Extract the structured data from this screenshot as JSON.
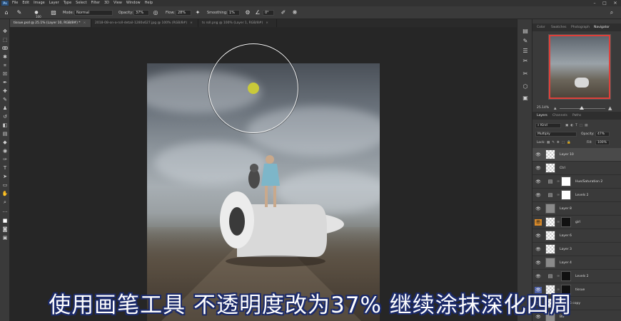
{
  "menubar": {
    "logo": "Ps",
    "items": [
      "File",
      "Edit",
      "Image",
      "Layer",
      "Type",
      "Select",
      "Filter",
      "3D",
      "View",
      "Window",
      "Help"
    ],
    "window_controls": [
      "–",
      "□",
      "✕"
    ]
  },
  "options": {
    "brush_size": "100",
    "mode_label": "Mode:",
    "mode_value": "Normal",
    "opacity_label": "Opacity:",
    "opacity_value": "37%",
    "flow_label": "Flow:",
    "flow_value": "28%",
    "smoothing_label": "Smoothing:",
    "smoothing_value": "1%",
    "angle_value": "0°"
  },
  "tabs": [
    {
      "label": "tissue.psd @ 25.1% (Layer 10, RGB/8#) *",
      "active": true
    },
    {
      "label": "2018-08-on-a-roll-detail-1280x627.jpg @ 100% (RGB/8#)",
      "active": false
    },
    {
      "label": "ts roll.png @ 100% (Layer 1, RGB/8#)",
      "active": false
    }
  ],
  "panels": {
    "top_tabs": [
      "Color",
      "Swatches",
      "Photograph",
      "Navigator"
    ],
    "zoom_value": "25.14%",
    "layers_tabs": [
      "Layers",
      "Channels",
      "Paths"
    ],
    "kind_label": "Kind",
    "blend_mode": "Multiply",
    "opacity_label": "Opacity:",
    "opacity_value": "47%",
    "lock_label": "Lock:",
    "fill_label": "Fill:",
    "fill_value": "100%"
  },
  "layers": [
    {
      "name": "Layer 10",
      "thumb": "checker",
      "active": true
    },
    {
      "name": "Ctrl",
      "thumb": "checker"
    },
    {
      "name": "Hue/Saturation 2",
      "thumb": "adjust",
      "mask": "white"
    },
    {
      "name": "Levels 2",
      "thumb": "adjust",
      "mask": "white"
    },
    {
      "name": "Layer 8",
      "thumb": "gray"
    },
    {
      "name": "girl",
      "thumb": "checker",
      "mask": "black",
      "highlight": "orange"
    },
    {
      "name": "Layer 6",
      "thumb": "checker"
    },
    {
      "name": "Layer 3",
      "thumb": "checker"
    },
    {
      "name": "Layer 4",
      "thumb": "gray"
    },
    {
      "name": "Levels 2",
      "thumb": "adjust",
      "mask": "black"
    },
    {
      "name": "tissue",
      "thumb": "checker",
      "mask": "black",
      "highlight": "blue"
    },
    {
      "name": "Layer 5 copy",
      "thumb": "checker"
    },
    {
      "name": "BG",
      "thumb": "gray"
    }
  ],
  "subtitle": "使用画笔工具 不透明度改为37% 继续涂抹深化四周"
}
